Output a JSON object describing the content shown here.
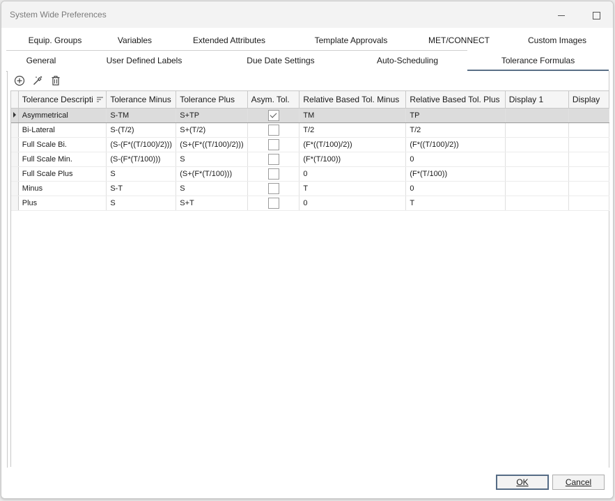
{
  "window": {
    "title": "System Wide Preferences"
  },
  "tabs_back": [
    {
      "label": "Equip. Groups"
    },
    {
      "label": "Variables"
    },
    {
      "label": "Extended Attributes"
    },
    {
      "label": "Template Approvals"
    },
    {
      "label": "MET/CONNECT"
    },
    {
      "label": "Custom Images"
    }
  ],
  "tabs_front": [
    {
      "label": "General"
    },
    {
      "label": "User Defined Labels"
    },
    {
      "label": "Due Date Settings"
    },
    {
      "label": "Auto-Scheduling"
    },
    {
      "label": "Tolerance Formulas",
      "active": true
    }
  ],
  "toolbar": {
    "add_icon": "add-circle-icon",
    "edit_icon": "magic-wand-icon",
    "delete_icon": "trash-icon"
  },
  "grid": {
    "columns": [
      "Tolerance Descripti",
      "Tolerance Minus",
      "Tolerance Plus",
      "Asym. Tol.",
      "Relative Based Tol. Minus",
      "Relative Based Tol. Plus",
      "Display 1",
      "Display"
    ],
    "rows": [
      {
        "desc": "Asymmetrical",
        "minus": "S-TM",
        "plus": "S+TP",
        "asym": true,
        "rel_minus": "TM",
        "rel_plus": "TP",
        "display1": "",
        "display2": ""
      },
      {
        "desc": "Bi-Lateral",
        "minus": "S-(T/2)",
        "plus": "S+(T/2)",
        "asym": false,
        "rel_minus": "T/2",
        "rel_plus": "T/2",
        "display1": "",
        "display2": ""
      },
      {
        "desc": "Full Scale Bi.",
        "minus": "(S-(F*((T/100)/2)))",
        "plus": "(S+(F*((T/100)/2)))",
        "asym": false,
        "rel_minus": "(F*((T/100)/2))",
        "rel_plus": "(F*((T/100)/2))",
        "display1": "",
        "display2": ""
      },
      {
        "desc": "Full Scale Min.",
        "minus": "(S-(F*(T/100)))",
        "plus": "S",
        "asym": false,
        "rel_minus": "(F*(T/100))",
        "rel_plus": "0",
        "display1": "",
        "display2": ""
      },
      {
        "desc": "Full Scale Plus",
        "minus": "S",
        "plus": "(S+(F*(T/100)))",
        "asym": false,
        "rel_minus": "0",
        "rel_plus": "(F*(T/100))",
        "display1": "",
        "display2": ""
      },
      {
        "desc": "Minus",
        "minus": "S-T",
        "plus": "S",
        "asym": false,
        "rel_minus": "T",
        "rel_plus": "0",
        "display1": "",
        "display2": ""
      },
      {
        "desc": "Plus",
        "minus": "S",
        "plus": "S+T",
        "asym": false,
        "rel_minus": "0",
        "rel_plus": "T",
        "display1": "",
        "display2": ""
      }
    ]
  },
  "buttons": {
    "ok": "OK",
    "cancel": "Cancel"
  },
  "colors": {
    "active_tab_underline": "#5a6f86",
    "selected_row": "#dcdcdc"
  }
}
